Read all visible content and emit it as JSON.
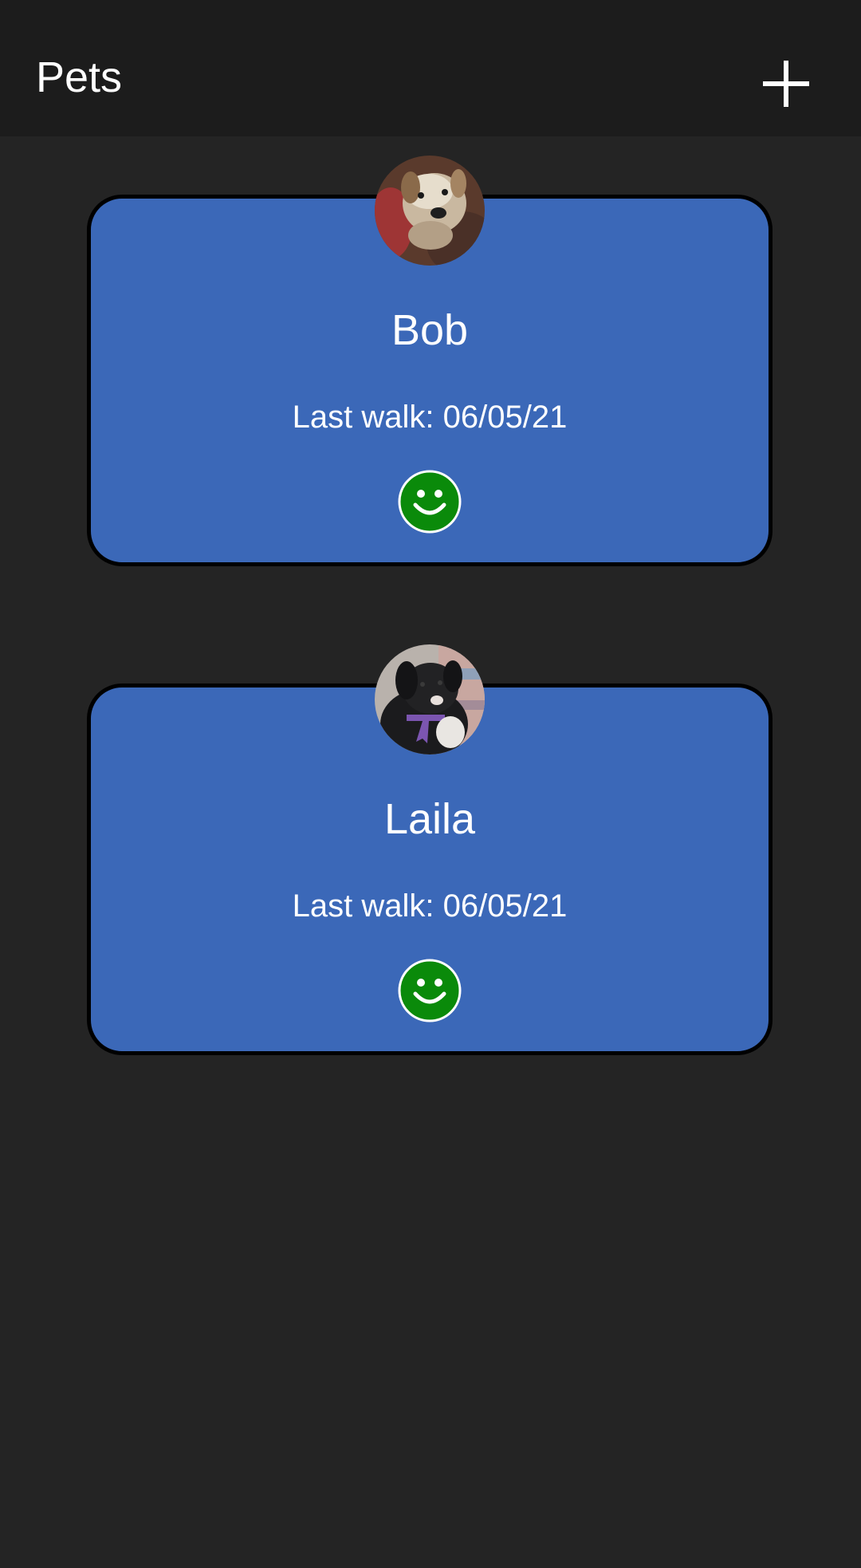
{
  "app_bar": {
    "title": "Pets",
    "add_icon": "plus-icon"
  },
  "pets": [
    {
      "name": "Bob",
      "last_walk": "Last walk: 06/05/21",
      "avatar": "dog-photo-bob",
      "status_icon": "smiley-face-icon",
      "status_color": "#0a8a0a"
    },
    {
      "name": "Laila",
      "last_walk": "Last walk: 06/05/21",
      "avatar": "dog-photo-laila",
      "status_icon": "smiley-face-icon",
      "status_color": "#0a8a0a"
    }
  ],
  "colors": {
    "background": "#242424",
    "app_bar": "#1c1c1c",
    "card": "#3b68b8",
    "card_border": "#000000",
    "text": "#ffffff"
  }
}
